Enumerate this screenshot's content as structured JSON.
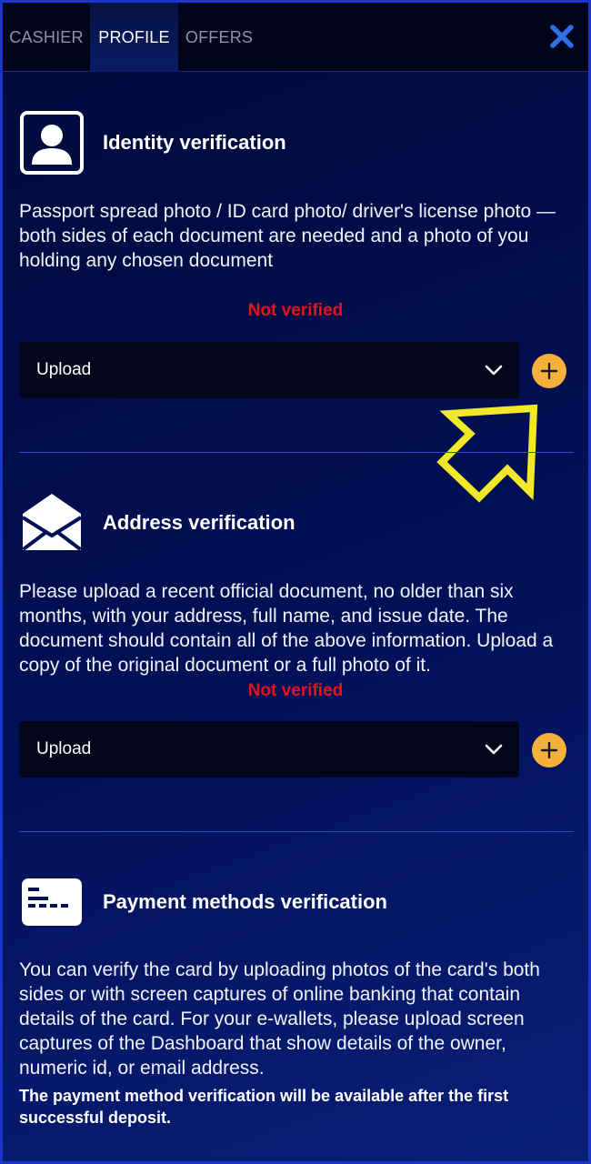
{
  "tabs": {
    "cashier": "CASHIER",
    "profile": "PROFILE",
    "offers": "OFFERS"
  },
  "colors": {
    "background": "#021057",
    "status_not_verified": "#e8121c",
    "add_button": "#f5b13c",
    "pointer_arrow": "#f2e82a",
    "divider": "#2c4ad6"
  },
  "identity": {
    "icon": "person-id-icon",
    "title": "Identity verification",
    "description": "Passport spread photo / ID card photo/ driver's license photo — both sides of each document are needed and a photo of you holding any chosen document",
    "status": "Not verified",
    "upload_label": "Upload"
  },
  "address": {
    "icon": "envelope-icon",
    "title": "Address verification",
    "description": "Please upload a recent official document, no older than six months, with your address, full name, and issue date. The document should contain all of the above information. Upload a copy of the original document or a full photo of it.",
    "status": "Not verified",
    "upload_label": "Upload"
  },
  "payment": {
    "icon": "card-icon",
    "title": "Payment methods verification",
    "description": "You can verify the card by uploading photos of the card's both sides or with screen captures of online banking that contain details of the card. For your e-wallets, please upload screen captures of the Dashboard that show details of the owner, numeric id, or email address.",
    "note": "The payment method verification will be available after the first successful deposit."
  }
}
